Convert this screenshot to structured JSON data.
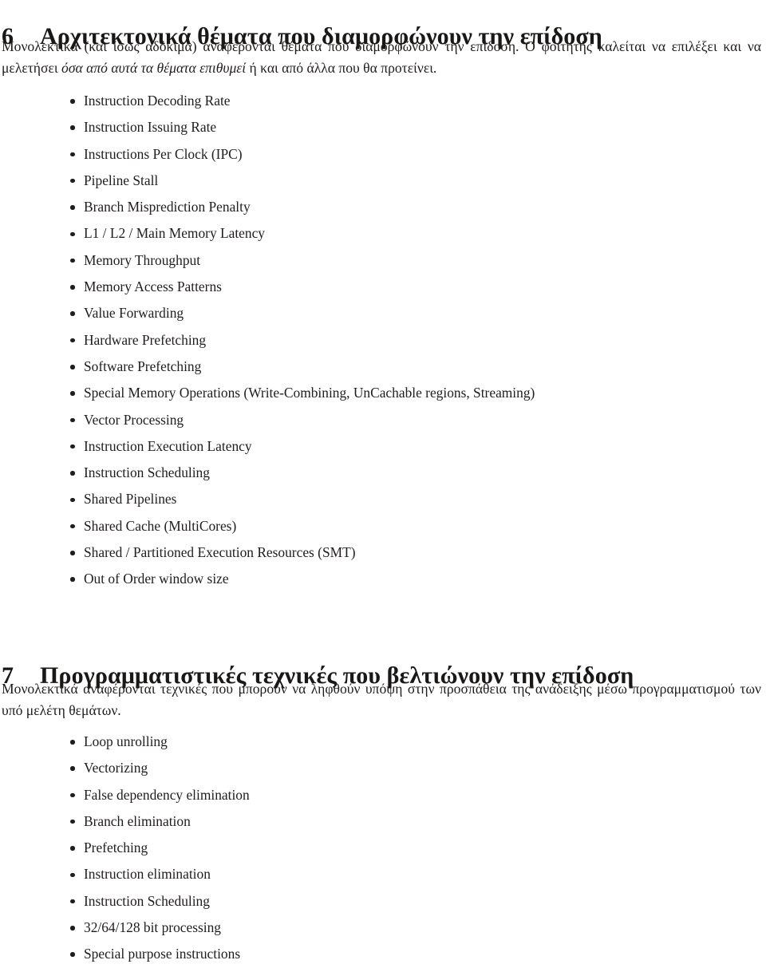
{
  "document": {
    "language": "el",
    "text_color": "#201d1c",
    "background_color": "#ffffff"
  },
  "sections": [
    {
      "number": "6",
      "title": "Αρχιτεκτονικά θέματα που διαμορφώνουν την επίδοση",
      "intro": {
        "lead": "Μονολεκτικά (και ίσως αδόκιμα) αναφέρονται θέματα που διαμορφώνουν την επίδοση. Ο φοιτητής καλείται να επιλέξει και να μελετήσει ",
        "italic": "όσα από αυτά τα θέματα επιθυμεί",
        "tail": " ή και από άλλα που θα προτείνει."
      },
      "bullets": [
        "Instruction Decoding Rate",
        "Instruction Issuing Rate",
        "Instructions Per Clock (IPC)",
        "Pipeline Stall",
        "Branch Misprediction Penalty",
        "L1 / L2 / Main Memory Latency",
        "Memory Throughput",
        "Memory Access Patterns",
        "Value Forwarding",
        "Hardware Prefetching",
        "Software Prefetching",
        "Special Memory Operations (Write-Combining, UnCachable regions, Streaming)",
        "Vector Processing",
        "Instruction Execution Latency",
        "Instruction Scheduling",
        "Shared Pipelines",
        "Shared Cache (MultiCores)",
        "Shared / Partitioned Execution Resources (SMT)",
        "Out of Order window size"
      ]
    },
    {
      "number": "7",
      "title": "Προγραμματιστικές τεχνικές που βελτιώνουν την επίδοση",
      "intro": {
        "lead": "Μονολεκτικά αναφέρονται τεχνικές που μπορούν να ληφθούν υπόψη στην προσπάθεια της ανάδειξης μέσω προγραμματισμού των υπό μελέτη θεμάτων.",
        "italic": "",
        "tail": ""
      },
      "bullets": [
        "Loop unrolling",
        "Vectorizing",
        "False dependency elimination",
        "Branch elimination",
        "Prefetching",
        "Instruction elimination",
        "Instruction Scheduling",
        "32/64/128 bit processing",
        "Special purpose instructions"
      ]
    }
  ]
}
